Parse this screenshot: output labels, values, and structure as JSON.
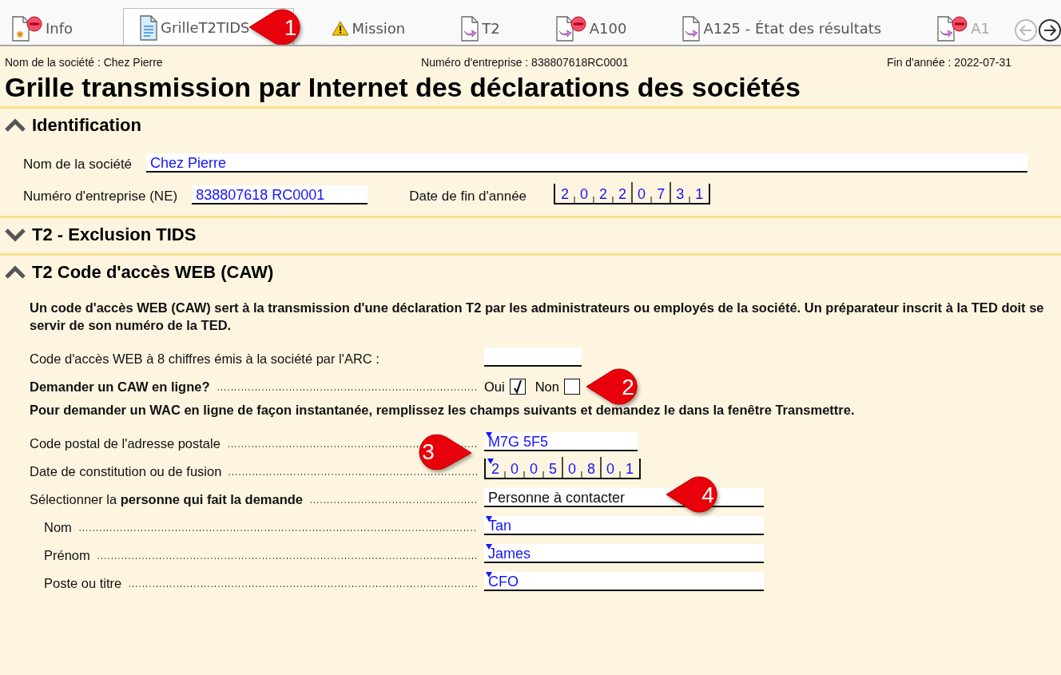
{
  "tabs": [
    {
      "label": "Info",
      "selected": false
    },
    {
      "label": "GrilleT2TIDS",
      "selected": true,
      "callout": "1"
    },
    {
      "label": "Mission",
      "selected": false
    },
    {
      "label": "T2",
      "selected": false
    },
    {
      "label": "A100",
      "selected": false
    },
    {
      "label": "A125 - État des résultats",
      "selected": false
    },
    {
      "label": "A1",
      "selected": false
    }
  ],
  "nav": [
    {
      "disabled": true
    },
    {
      "disabled": false
    }
  ],
  "header": [
    "Nom de la société : Chez Pierre",
    "Numéro d'entreprise : 838807618RC0001",
    "Fin d'année : 2022-07-31"
  ],
  "title": "Grille transmission par Internet des déclarations des sociétés",
  "identification": {
    "title": "Identification",
    "expanded": true,
    "rows": [
      [
        {
          "kind": "text",
          "label": "Nom de la société",
          "value": "Chez Pierre"
        }
      ],
      [
        {
          "kind": "text",
          "label": "Numéro d'entreprise (NE)",
          "value": "838807618 RC0001"
        },
        {
          "kind": "comb",
          "label": "Date de fin d'année",
          "value": "20220731"
        }
      ]
    ]
  },
  "exclusion": {
    "title": "T2 - Exclusion TIDS",
    "expanded": false
  },
  "caw": {
    "title": "T2 Code d'accès WEB (CAW)",
    "expanded": true,
    "rows": [
      {
        "kind": "paragraph",
        "label": "Un code d'accès WEB (CAW) sert à la transmission d'une déclaration T2 par les administrateurs ou employés de la société. Un préparateur inscrit à la TED doit se servir de son numéro de la TED."
      },
      {
        "kind": "short-field",
        "label": "Code d'accès WEB à 8 chiffres émis à la société par l'ARC :"
      },
      {
        "kind": "choice",
        "label": "Demander un CAW en ligne?",
        "options": [
          {
            "label": "Oui",
            "checked": true
          },
          {
            "label": "Non",
            "checked": false,
            "callout": "2"
          }
        ]
      },
      {
        "kind": "paragraph",
        "label": "Pour demander un WAC en ligne de façon instantanée, remplissez les champs suivants et demandez le dans la fenêtre Transmettre."
      },
      {
        "kind": "field",
        "label": "Code postal de l'adresse postale",
        "value": "M7G 5F5",
        "marker": true,
        "callout": "3"
      },
      {
        "kind": "comb",
        "label": "Date de constitution ou de fusion",
        "value": "20050801",
        "marker": true
      },
      {
        "kind": "select",
        "label": "Sélectionner la **personne qui fait la demande**",
        "value": "Personne à contacter",
        "callout": "4",
        "children": [
          {
            "kind": "field",
            "label": "Nom",
            "value": "Tan",
            "marker": true
          },
          {
            "kind": "field",
            "label": "Prénom",
            "value": "James",
            "marker": true
          },
          {
            "kind": "field",
            "label": "Poste ou titre",
            "value": "CFO",
            "marker": true
          }
        ]
      }
    ]
  }
}
